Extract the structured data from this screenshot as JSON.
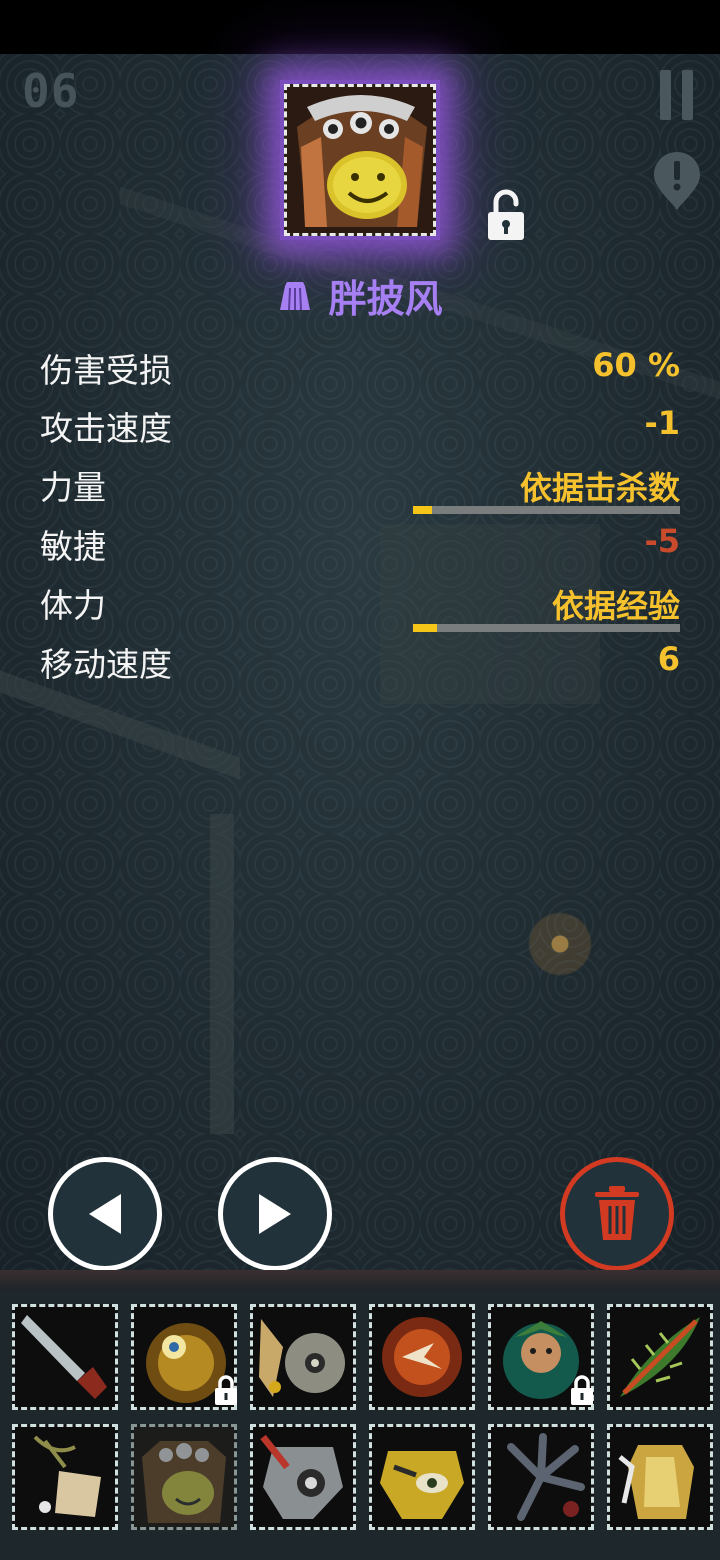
{
  "hud": {
    "level": "06"
  },
  "item": {
    "name": "胖披风",
    "name_color": "#a67ff2",
    "type_icon": "cape-icon",
    "portrait_icon": "fat-cloak-portrait",
    "lock_icon": "unlocked-padlock-icon"
  },
  "stats": [
    {
      "label": "伤害受损",
      "value": "60 %"
    },
    {
      "label": "攻击速度",
      "value": "-1"
    },
    {
      "label": "力量",
      "value": "依据击杀数",
      "progress": 0.07
    },
    {
      "label": "敏捷",
      "value": "-5"
    },
    {
      "label": "体力",
      "value": "依据经验",
      "progress": 0.09
    },
    {
      "label": "移动速度",
      "value": "6"
    }
  ],
  "colors": {
    "accent": "#f5c22d",
    "negative": "#c94b2b",
    "trash": "#d23a22",
    "glow": "#8a55d8"
  },
  "controls": {
    "prev_icon": "triangle-left-icon",
    "next_icon": "triangle-right-icon",
    "delete_icon": "trash-can-icon",
    "pause_icon": "pause-icon",
    "alert_icon": "exclamation-pin-icon"
  },
  "inventory": [
    {
      "icon": "dagger-item-icon",
      "locked": false
    },
    {
      "icon": "sun-amulet-item-icon",
      "locked": true
    },
    {
      "icon": "skull-item-icon",
      "locked": false
    },
    {
      "icon": "fire-orb-item-icon",
      "locked": false
    },
    {
      "icon": "jester-item-icon",
      "locked": true
    },
    {
      "icon": "leaf-item-icon",
      "locked": false
    },
    {
      "icon": "root-item-icon",
      "locked": false
    },
    {
      "icon": "fat-cloak-item-icon",
      "locked": false
    },
    {
      "icon": "stone-mask-item-icon",
      "locked": false
    },
    {
      "icon": "yellow-mask-item-icon",
      "locked": false
    },
    {
      "icon": "claw-item-icon",
      "locked": false
    },
    {
      "icon": "golden-armor-item-icon",
      "locked": false
    }
  ]
}
